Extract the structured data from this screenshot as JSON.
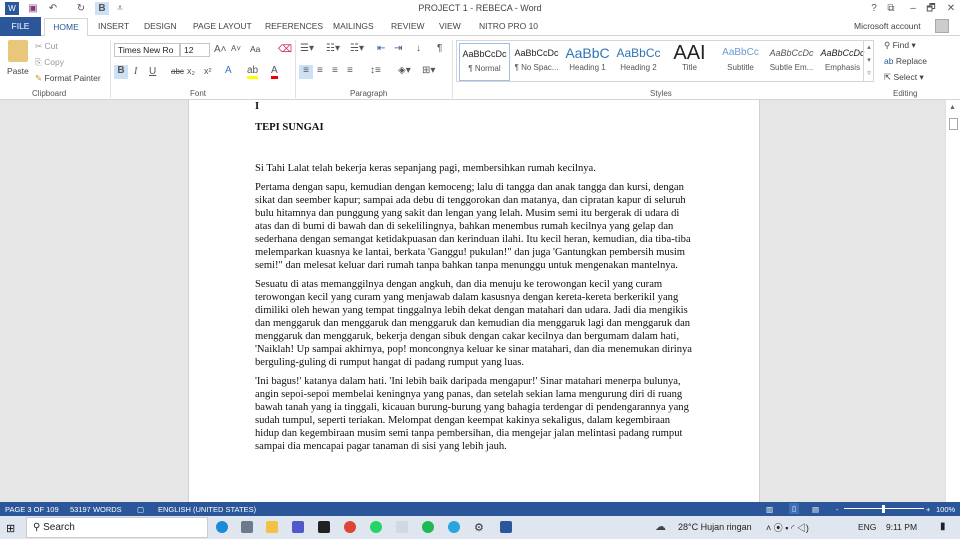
{
  "title": "PROJECT 1 - REBECA - Word",
  "qat": {
    "bold_label": "B"
  },
  "window_controls": [
    "?",
    "⧉",
    "–",
    "🗗",
    "✕"
  ],
  "tabs": {
    "file": "FILE",
    "home": "HOME",
    "items": [
      "INSERT",
      "DESIGN",
      "PAGE LAYOUT",
      "REFERENCES",
      "MAILINGS",
      "REVIEW",
      "VIEW",
      "NITRO PRO 10"
    ]
  },
  "account": "Microsoft account",
  "clipboard": {
    "paste": "Paste",
    "cut": "Cut",
    "copy": "Copy",
    "format_painter": "Format Painter",
    "group": "Clipboard"
  },
  "font": {
    "name": "Times New Ro",
    "size": "12",
    "group": "Font",
    "bold": "B",
    "italic": "I",
    "underline": "U",
    "strike": "abc",
    "sub": "x₂",
    "sup": "x²",
    "case": "Aa"
  },
  "paragraph": {
    "group": "Paragraph"
  },
  "styles": {
    "group": "Styles",
    "items": [
      {
        "preview": "AaBbCcDc",
        "label": "¶ Normal"
      },
      {
        "preview": "AaBbCcDc",
        "label": "¶ No Spac..."
      },
      {
        "preview": "AaBbC",
        "label": "Heading 1"
      },
      {
        "preview": "AaBbCc",
        "label": "Heading 2"
      },
      {
        "preview": "AAI",
        "label": "Title"
      },
      {
        "preview": "AaBbCc",
        "label": "Subtitle"
      },
      {
        "preview": "AaBbCcDc",
        "label": "Subtle Em..."
      },
      {
        "preview": "AaBbCcDc",
        "label": "Emphasis"
      }
    ]
  },
  "editing": {
    "find": "Find",
    "replace": "Replace",
    "select": "Select",
    "group": "Editing"
  },
  "document": {
    "chapter": "I",
    "heading": "TEPI SUNGAI",
    "paragraphs": [
      "Si Tahi Lalat telah bekerja keras sepanjang pagi, membersihkan rumah kecilnya.",
      "Pertama dengan sapu, kemudian dengan kemoceng; lalu di tangga dan anak tangga dan kursi, dengan sikat dan seember kapur; sampai ada debu di tenggorokan dan matanya, dan cipratan kapur di seluruh bulu hitamnya dan punggung yang sakit dan lengan yang lelah. Musim semi itu bergerak di udara di atas dan di bumi di bawah dan di sekelilingnya, bahkan menembus rumah kecilnya yang gelap dan sederhana dengan semangat ketidakpuasan dan kerinduan ilahi. Itu kecil heran, kemudian, dia tiba-tiba melemparkan kuasnya ke lantai, berkata 'Ganggu! pukulan!\" dan juga 'Gantungkan pembersih musim semi!\" dan melesat keluar dari rumah tanpa bahkan tanpa menunggu untuk mengenakan mantelnya.",
      "Sesuatu di atas memanggilnya dengan angkuh, dan dia menuju ke terowongan kecil yang curam terowongan kecil yang curam yang menjawab dalam kasusnya dengan kereta-kereta berkerikil yang dimiliki oleh hewan yang tempat tinggalnya lebih dekat dengan matahari dan udara. Jadi dia mengikis dan menggaruk dan menggaruk dan menggaruk dan kemudian dia menggaruk lagi dan menggaruk dan menggaruk dan menggaruk, bekerja dengan sibuk dengan cakar kecilnya dan bergumam dalam hati, 'Naiklah! Up sampai akhirnya, pop! moncongnya keluar ke sinar matahari, dan dia menemukan dirinya berguling-guling di rumput hangat di padang rumput yang luas.",
      "'Ini bagus!' katanya dalam hati. 'Ini lebih baik daripada mengapur!' Sinar matahari menerpa bulunya, angin sepoi-sepoi membelai keningnya yang panas, dan setelah sekian lama mengurung diri di ruang bawah tanah yang ia tinggali, kicauan burung-burung yang bahagia terdengar di pendengarannya yang sudah tumpul, seperti teriakan. Melompat dengan keempat kakinya sekaligus, dalam kegembiraan hidup dan kegembiraan musim semi tanpa pembersihan, dia mengejar jalan melintasi padang rumput sampai dia mencapai pagar tanaman di sisi yang lebih jauh."
    ]
  },
  "status": {
    "page": "PAGE 3 OF 109",
    "words": "53197 WORDS",
    "language": "ENGLISH (UNITED STATES)",
    "zoom": "100%",
    "zoom_level_percent": 100
  },
  "taskbar": {
    "search": "Search",
    "weather": "28°C  Hujan ringan",
    "lang": "ENG",
    "time": "9:11 PM"
  },
  "colors": {
    "accent": "#2b579a"
  }
}
